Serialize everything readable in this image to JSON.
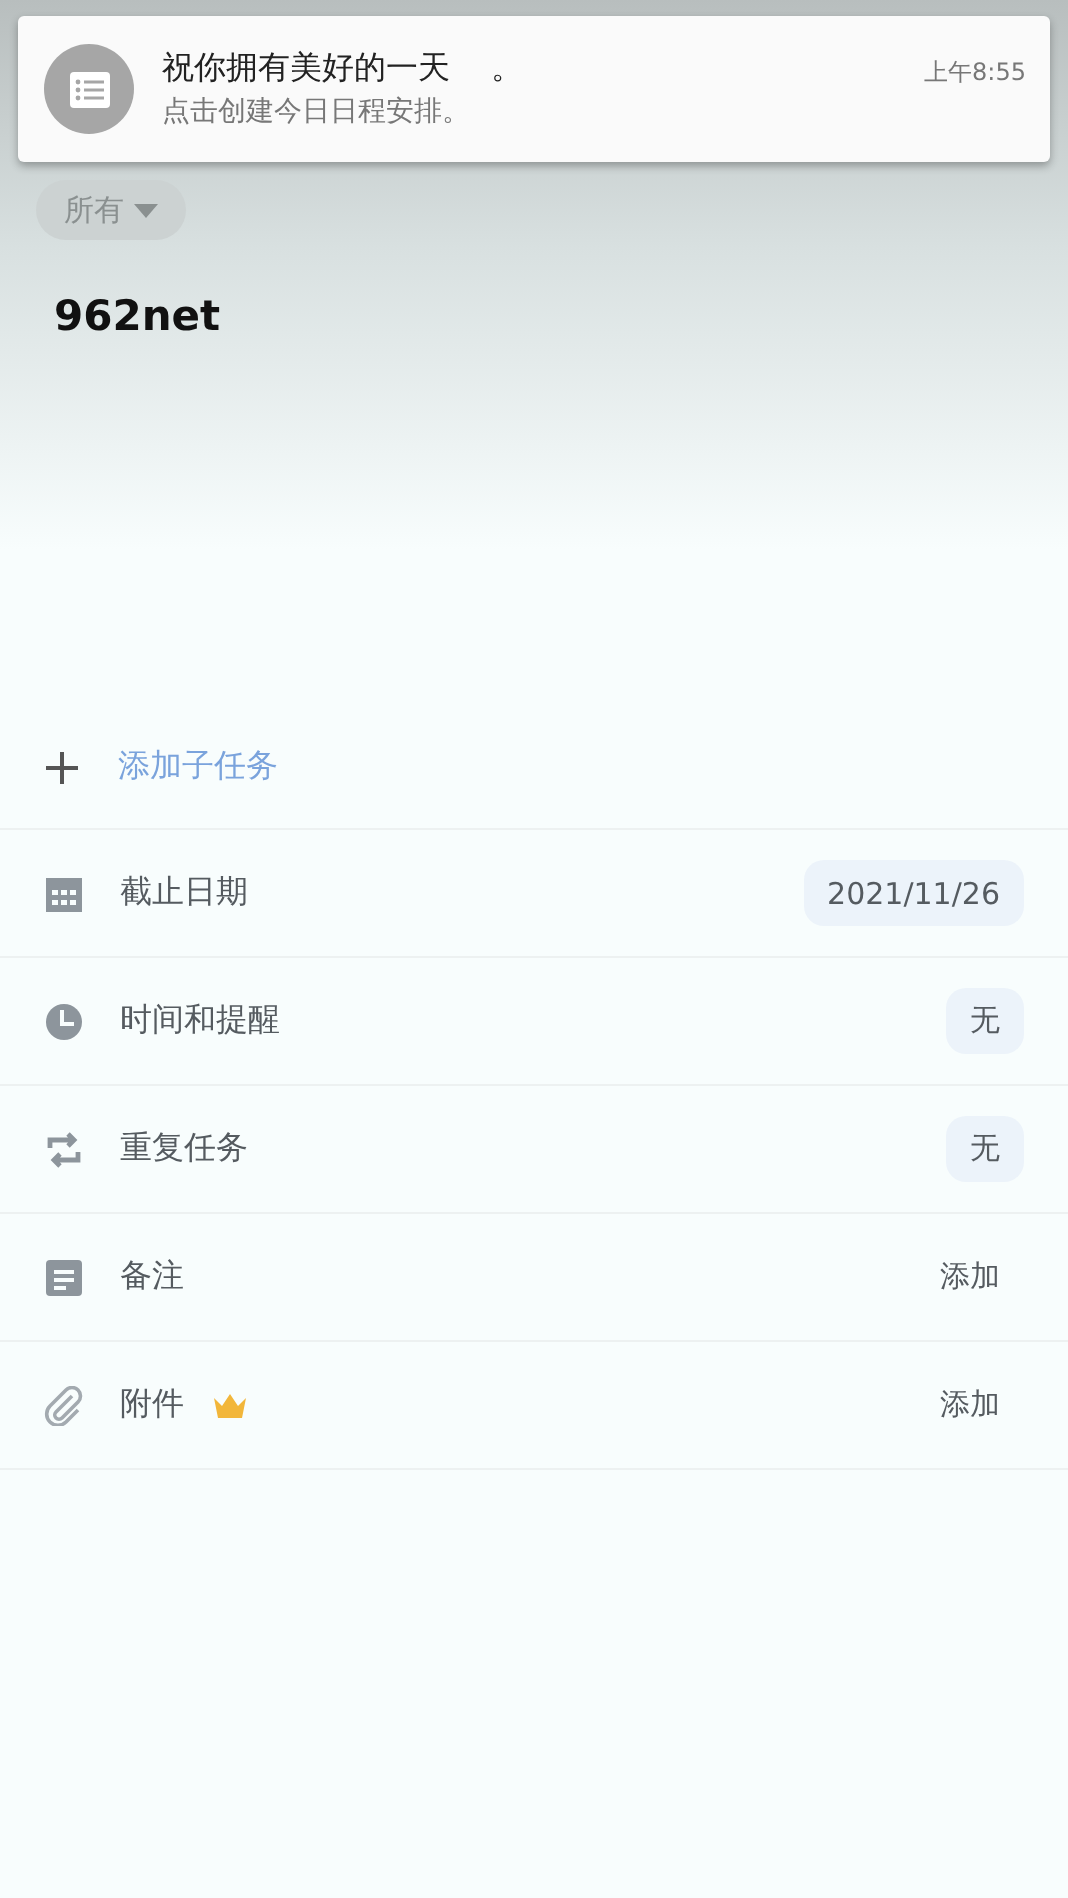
{
  "notification": {
    "title": "祝你拥有美好的一天    。",
    "message": "点击创建今日日程安排。",
    "time": "上午8:55"
  },
  "filter": {
    "label": "所有"
  },
  "task": {
    "title": "962net"
  },
  "add_subtask": {
    "label": "添加子任务"
  },
  "rows": [
    {
      "label": "截止日期",
      "value": "2021/11/26",
      "kind": "chip",
      "premium": false
    },
    {
      "label": "时间和提醒",
      "value": "无",
      "kind": "chip",
      "premium": false
    },
    {
      "label": "重复任务",
      "value": "无",
      "kind": "chip",
      "premium": false
    },
    {
      "label": "备注",
      "value": "添加",
      "kind": "plain",
      "premium": false
    },
    {
      "label": "附件",
      "value": "添加",
      "kind": "plain",
      "premium": true
    }
  ]
}
